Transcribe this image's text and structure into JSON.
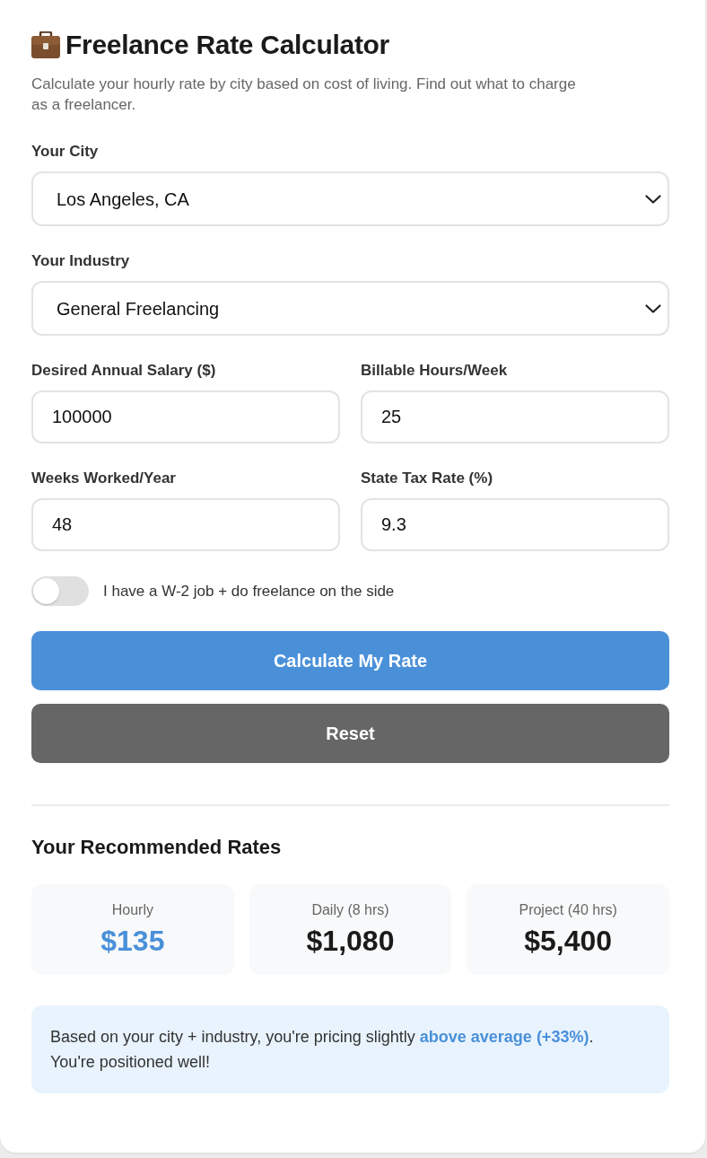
{
  "title": "Freelance Rate Calculator",
  "subtitle": "Calculate your hourly rate by city based on cost of living. Find out what to charge as a freelancer.",
  "fields": [
    {
      "kind": "select",
      "label": "Your City",
      "value": "Los Angeles, CA"
    },
    {
      "kind": "select",
      "label": "Your Industry",
      "value": "General Freelancing"
    },
    {
      "kind": "input",
      "label": "Desired Annual Salary ($)",
      "value": "100000"
    },
    {
      "kind": "input",
      "label": "Billable Hours/Week",
      "value": "25"
    },
    {
      "kind": "input",
      "label": "Weeks Worked/Year",
      "value": "48"
    },
    {
      "kind": "input",
      "label": "State Tax Rate (%)",
      "value": "9.3"
    }
  ],
  "toggle": {
    "label": "I have a W-2 job + do freelance on the side",
    "on": false
  },
  "buttons": [
    {
      "kind": "primary",
      "label": "Calculate My Rate"
    },
    {
      "kind": "secondary",
      "label": "Reset"
    }
  ],
  "results": {
    "heading": "Your Recommended Rates",
    "rates": [
      {
        "label": "Hourly",
        "value": "$135",
        "highlighted": true
      },
      {
        "label": "Daily (8 hrs)",
        "value": "$1,080",
        "highlighted": false
      },
      {
        "label": "Project (40 hrs)",
        "value": "$5,400",
        "highlighted": false
      }
    ]
  },
  "insight": {
    "text": "Based on your city + industry, you're pricing slightly **above average (+33%)**. You're positioned well!"
  }
}
